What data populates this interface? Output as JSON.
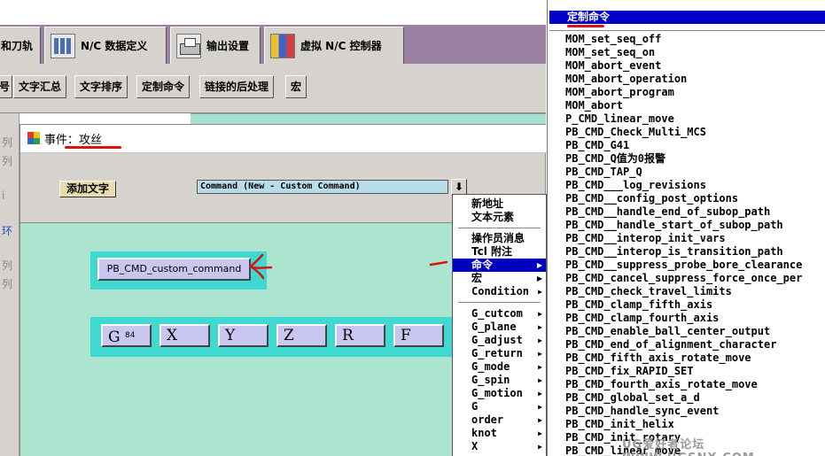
{
  "main_tabs": [
    {
      "label": "和刀轨",
      "icon": "none"
    },
    {
      "label": "N/C 数据定义",
      "icon": "grid-icon"
    },
    {
      "label": "输出设置",
      "icon": "printer-icon"
    },
    {
      "label": "虚拟 N/C 控制器",
      "icon": "machine-icon"
    }
  ],
  "sub_tabs": [
    "号",
    "文字汇总",
    "文字排序",
    "定制命令",
    "链接的后处理",
    "宏"
  ],
  "left_panel_chars": [
    "列",
    "列",
    "i",
    "环",
    "列",
    "列"
  ],
  "dialog": {
    "title_prefix": "事件：",
    "title_value": "攻丝",
    "add_text_button": "添加文字",
    "command_field": "Command (New - Custom Command)",
    "dropdown_glyph": "⬇",
    "custom_command_button": "PB_CMD_custom_command",
    "address_buttons": [
      {
        "letter": "G",
        "sup": "84"
      },
      {
        "letter": "X",
        "sup": ""
      },
      {
        "letter": "Y",
        "sup": ""
      },
      {
        "letter": "Z",
        "sup": ""
      },
      {
        "letter": "R",
        "sup": ""
      },
      {
        "letter": "F",
        "sup": ""
      }
    ]
  },
  "context_menu": {
    "group1": [
      "新地址",
      "文本元素"
    ],
    "group2": [
      {
        "label": "操作员消息",
        "submenu": false,
        "highlighted": false
      },
      {
        "label": "Tcl 附注",
        "submenu": false,
        "highlighted": false
      },
      {
        "label": "命令",
        "submenu": true,
        "highlighted": true
      },
      {
        "label": "宏",
        "submenu": true,
        "highlighted": false
      },
      {
        "label": "Condition",
        "submenu": true,
        "highlighted": false
      }
    ],
    "group3": [
      "G_cutcom",
      "G_plane",
      "G_adjust",
      "G_return",
      "G_mode",
      "G_spin",
      "G_motion",
      "G",
      "order",
      "knot",
      "X"
    ]
  },
  "submenu": {
    "header": "定制命令",
    "items": [
      "MOM_set_seq_off",
      "MOM_set_seq_on",
      "MOM_abort_event",
      "MOM_abort_operation",
      "MOM_abort_program",
      "MOM_abort",
      "P_CMD_linear_move",
      "PB_CMD_Check_Multi_MCS",
      "PB_CMD_G41",
      "PB_CMD_Q值为0报警",
      "PB_CMD_TAP_Q",
      "PB_CMD___log_revisions",
      "PB_CMD__config_post_options",
      "PB_CMD__handle_end_of_subop_path",
      "PB_CMD__handle_start_of_subop_path",
      "PB_CMD__interop_init_vars",
      "PB_CMD__interop_is_transition_path",
      "PB_CMD__suppress_probe_bore_clearance",
      "PB_CMD_cancel_suppress_force_once_per",
      "PB_CMD_check_travel_limits",
      "PB_CMD_clamp_fifth_axis",
      "PB_CMD_clamp_fourth_axis",
      "PB_CMD_enable_ball_center_output",
      "PB_CMD_end_of_alignment_character",
      "PB_CMD_fifth_axis_rotate_move",
      "PB_CMD_fix_RAPID_SET",
      "PB_CMD_fourth_axis_rotate_move",
      "PB_CMD_global_set_a_d",
      "PB_CMD_handle_sync_event",
      "PB_CMD_init_helix",
      "PB_CMD_init_rotary",
      "PB_CMD_linear_move"
    ]
  },
  "watermark": "UG爱好者论坛 WWW.UGSNX.COM",
  "colors": {
    "tab_bg": "#d6d3ce",
    "tab_strip": "#9b82a3",
    "canvas": "#abe5cf",
    "frame": "#40d9d2",
    "block_button": "#c9c7f0",
    "highlight": "#0000c0",
    "annotation_red": "#dd1111"
  }
}
